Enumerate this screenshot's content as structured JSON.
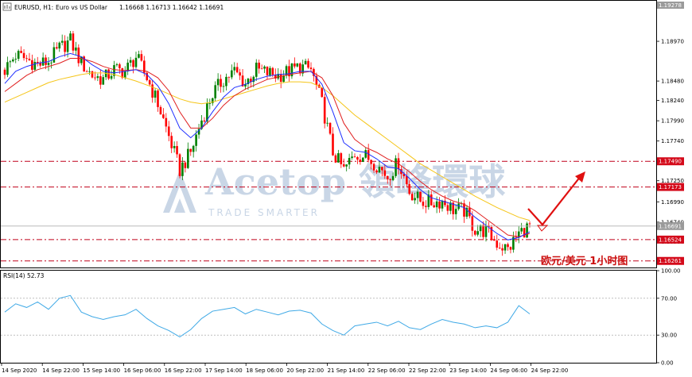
{
  "header": {
    "symbol": "EURUSD, H1:",
    "description": "Euro vs US Dollar",
    "ohlc": "1.16668 1.16713 1.16642 1.16691"
  },
  "rsi_label": "RSI(14) 52.73",
  "watermark": {
    "main": "Acetop 領峰環球",
    "sub": "TRADE SMARTER"
  },
  "caption": "欧元/美元 1小时图",
  "colors": {
    "bull": "#008000",
    "bear": "#ff0000",
    "ma_fast": "#1f2fff",
    "ma_mid": "#e02020",
    "ma_slow": "#f5c518",
    "rsi": "#3fa9e6",
    "level_line": "#c0001a",
    "level_tag": "#d40a1a",
    "current_tag": "#9a9a9a"
  },
  "chart_data": [
    {
      "type": "line",
      "panel": "price",
      "y_ticks": [
        "1.18970",
        "1.18480",
        "1.18240",
        "1.17990",
        "1.17740",
        "1.17250",
        "1.16990",
        "1.16740",
        "1.16500"
      ],
      "ylim": [
        1.1619,
        1.1946
      ],
      "x_ticks": [
        "14 Sep 2020",
        "14 Sep 22:00",
        "15 Sep 14:00",
        "16 Sep 06:00",
        "16 Sep 22:00",
        "17 Sep 14:00",
        "18 Sep 06:00",
        "20 Sep 22:00",
        "21 Sep 14:00",
        "22 Sep 06:00",
        "22 Sep 22:00",
        "23 Sep 14:00",
        "24 Sep 06:00",
        "24 Sep 22:00"
      ],
      "top_tag": "1.19278",
      "current_price": "1.16691",
      "levels": [
        "1.17490",
        "1.17173",
        "1.16524",
        "1.16261"
      ],
      "series": [
        {
          "name": "close",
          "values": [
            1.1862,
            1.188,
            1.1875,
            1.1868,
            1.1872,
            1.1888,
            1.1898,
            1.187,
            1.1855,
            1.185,
            1.1862,
            1.186,
            1.1878,
            1.1852,
            1.182,
            1.178,
            1.1738,
            1.176,
            1.18,
            1.1832,
            1.185,
            1.186,
            1.1845,
            1.1862,
            1.1858,
            1.1855,
            1.186,
            1.1866,
            1.1862,
            1.182,
            1.176,
            1.1738,
            1.1758,
            1.1755,
            1.1745,
            1.173,
            1.1748,
            1.1712,
            1.17,
            1.1698,
            1.17,
            1.169,
            1.1688,
            1.1665,
            1.1663,
            1.1648,
            1.164,
            1.166,
            1.1669
          ]
        },
        {
          "name": "ma_fast",
          "values": [
            1.1845,
            1.186,
            1.1866,
            1.187,
            1.1872,
            1.1878,
            1.1882,
            1.1878,
            1.1868,
            1.186,
            1.1858,
            1.186,
            1.1862,
            1.1856,
            1.1842,
            1.182,
            1.179,
            1.1778,
            1.179,
            1.181,
            1.1828,
            1.184,
            1.1844,
            1.185,
            1.1854,
            1.1856,
            1.1857,
            1.186,
            1.186,
            1.1844,
            1.181,
            1.1772,
            1.1762,
            1.176,
            1.1752,
            1.1742,
            1.174,
            1.1728,
            1.1714,
            1.1704,
            1.17,
            1.1696,
            1.1692,
            1.168,
            1.167,
            1.166,
            1.1652,
            1.1655,
            1.1662
          ]
        },
        {
          "name": "ma_mid",
          "values": [
            1.1835,
            1.1845,
            1.1855,
            1.1862,
            1.1866,
            1.187,
            1.1876,
            1.1876,
            1.1872,
            1.1866,
            1.1862,
            1.1861,
            1.1862,
            1.186,
            1.1852,
            1.1836,
            1.181,
            1.179,
            1.179,
            1.1802,
            1.1818,
            1.183,
            1.1838,
            1.1844,
            1.185,
            1.1853,
            1.1856,
            1.1858,
            1.186,
            1.1852,
            1.183,
            1.1796,
            1.1776,
            1.1766,
            1.176,
            1.1752,
            1.1746,
            1.1736,
            1.1724,
            1.1714,
            1.1706,
            1.17,
            1.1696,
            1.1688,
            1.1678,
            1.1668,
            1.1658,
            1.1656,
            1.166
          ]
        },
        {
          "name": "ma_slow",
          "values": [
            1.1822,
            1.1828,
            1.1834,
            1.184,
            1.1846,
            1.185,
            1.1853,
            1.1856,
            1.1858,
            1.1858,
            1.1856,
            1.1852,
            1.1848,
            1.1843,
            1.1838,
            1.1832,
            1.1826,
            1.1822,
            1.182,
            1.1822,
            1.1826,
            1.183,
            1.1834,
            1.1838,
            1.1842,
            1.1845,
            1.1847,
            1.1847,
            1.1846,
            1.184,
            1.183,
            1.1818,
            1.1806,
            1.1796,
            1.1786,
            1.1776,
            1.1766,
            1.1756,
            1.1746,
            1.1738,
            1.173,
            1.1722,
            1.1714,
            1.1706,
            1.1699,
            1.1692,
            1.1686,
            1.168,
            1.1676
          ]
        }
      ]
    },
    {
      "type": "line",
      "panel": "rsi",
      "y_ticks": [
        "100.00",
        "70.00",
        "30.00",
        "0.00"
      ],
      "ylim": [
        0,
        100
      ],
      "series": [
        {
          "name": "RSI(14)",
          "values": [
            55,
            64,
            60,
            66,
            58,
            70,
            73,
            55,
            50,
            47,
            50,
            52,
            58,
            48,
            40,
            35,
            28,
            36,
            48,
            56,
            58,
            60,
            53,
            58,
            55,
            52,
            56,
            57,
            54,
            42,
            35,
            30,
            40,
            42,
            44,
            40,
            45,
            38,
            36,
            42,
            47,
            44,
            42,
            38,
            40,
            38,
            44,
            62,
            53
          ]
        }
      ]
    }
  ]
}
